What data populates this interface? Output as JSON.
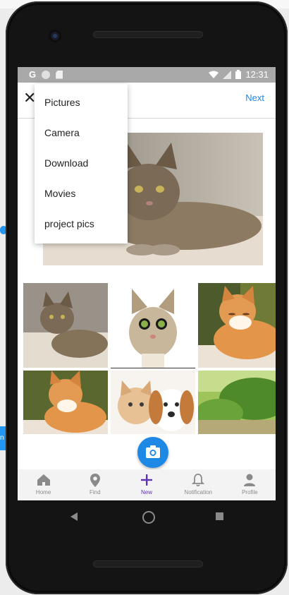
{
  "app": {
    "top_bar": {
      "next_label": "Next"
    },
    "folder_dropdown": {
      "items": [
        "Pictures",
        "Camera",
        "Download",
        "Movies",
        "project pics"
      ]
    },
    "bottom_nav": {
      "items": [
        {
          "label": "Home",
          "icon": "home-icon"
        },
        {
          "label": "Find",
          "icon": "map-pin-icon"
        },
        {
          "label": "New",
          "icon": "plus-icon",
          "active": true
        },
        {
          "label": "Notification",
          "icon": "bell-icon"
        },
        {
          "label": "Profile",
          "icon": "person-icon"
        }
      ]
    },
    "status_bar": {
      "time": "12:31",
      "carrier_glyph": "G"
    },
    "fab": {
      "icon": "camera-icon"
    },
    "colors": {
      "accent": "#1e88e5",
      "active_nav": "#5e35b1",
      "status_bar": "#a9a9a9"
    }
  }
}
